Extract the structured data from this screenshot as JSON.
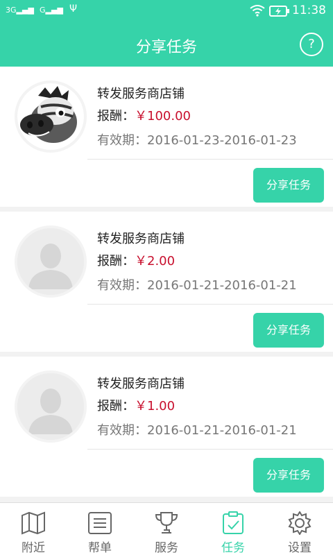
{
  "status_bar": {
    "signal1": "3G",
    "signal2": "G",
    "usb": "Ψ",
    "time": "11:38"
  },
  "header": {
    "title": "分享任务",
    "help_label": "?"
  },
  "tasks": [
    {
      "name": "转发服务商店铺",
      "reward_label": "报酬：",
      "reward_amount": "￥100.00",
      "validity_label": "有效期：",
      "validity_dates": "2016-01-23-2016-01-23",
      "button_label": "分享任务",
      "avatar": "zebra-mascot"
    },
    {
      "name": "转发服务商店铺",
      "reward_label": "报酬：",
      "reward_amount": "￥2.00",
      "validity_label": "有效期：",
      "validity_dates": "2016-01-21-2016-01-21",
      "button_label": "分享任务",
      "avatar": "default-person"
    },
    {
      "name": "转发服务商店铺",
      "reward_label": "报酬：",
      "reward_amount": "￥1.00",
      "validity_label": "有效期：",
      "validity_dates": "2016-01-21-2016-01-21",
      "button_label": "分享任务",
      "avatar": "default-person"
    }
  ],
  "tabbar": {
    "items": [
      {
        "label": "附近",
        "icon": "map-icon"
      },
      {
        "label": "帮单",
        "icon": "list-icon"
      },
      {
        "label": "服务",
        "icon": "trophy-icon"
      },
      {
        "label": "任务",
        "icon": "task-icon",
        "active": true
      },
      {
        "label": "设置",
        "icon": "gear-icon"
      }
    ]
  },
  "colors": {
    "accent": "#36d3a9",
    "price": "#c8102e"
  }
}
